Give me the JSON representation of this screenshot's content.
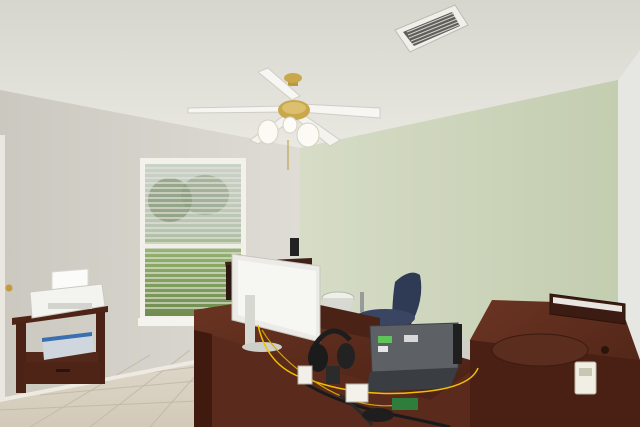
{
  "scene": {
    "kind": "photo",
    "colors": {
      "ceiling": "#e4e3dc",
      "wall_left": "#d9d7cf",
      "wall_green": "#cdd6bb",
      "floor": "#ddd5c6",
      "desk": "#5a2a1c",
      "chair": "#2f3a55",
      "window_view": "#8fae6a"
    }
  }
}
